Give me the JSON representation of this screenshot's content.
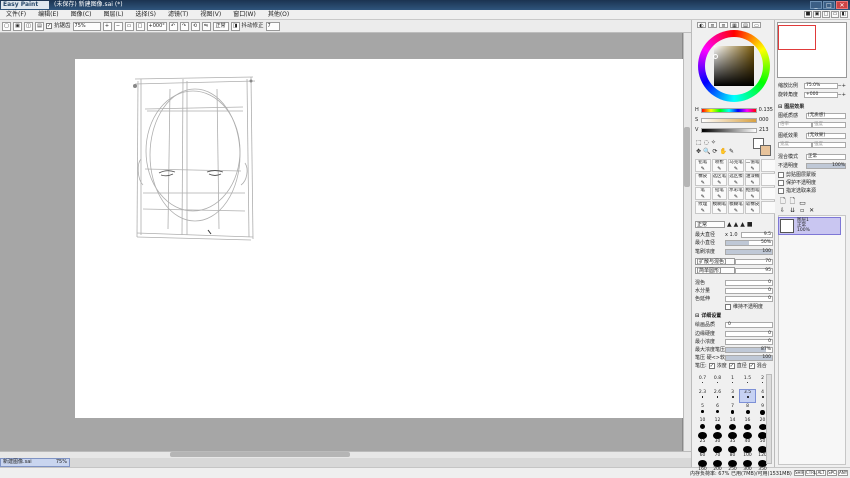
{
  "app": {
    "logo": "Easy Paint Tool SAI",
    "window_title": "(未保存) 新建图像.sai (*)",
    "window_buttons": [
      "_",
      "□",
      "✕"
    ]
  },
  "menu": {
    "items": [
      "文件(F)",
      "编辑(E)",
      "图像(C)",
      "图层(L)",
      "选择(S)",
      "滤镜(T)",
      "视图(V)",
      "窗口(W)",
      "其他(O)"
    ],
    "right_buttons": [
      "■",
      "▣",
      "□",
      "▭",
      "◧"
    ]
  },
  "toolbar": {
    "anti_alias_label": "抗锯齿",
    "zoom_value": "75%",
    "rotation_value": "+000°",
    "normal_label": "正常",
    "stabilizer_label": "抖动修正",
    "stabilizer_value": "7"
  },
  "file_tab": {
    "name": "新建图像.sai",
    "zoom": "75%"
  },
  "status": {
    "memory": "内存负荷率: 67%  已用(7MB)/可用(1531MB)",
    "buttons": [
      "SHIFT",
      "CTRL",
      "ALT",
      "SPC",
      "ANY"
    ]
  },
  "color": {
    "hue_color": "#7a5a0a",
    "sliders": [
      {
        "label": "H",
        "value": "0.135",
        "fill": "#b98d2a",
        "pct": 0.38
      },
      {
        "label": "S",
        "value": "000",
        "fill": "#d8c48e",
        "pct": 0.0
      },
      {
        "label": "V",
        "value": "213",
        "fill": "#6a6a6a",
        "pct": 0.84
      }
    ],
    "main_swatch": "#ffffff",
    "sub_swatch": "#e8c39a"
  },
  "tools": {
    "brushes": [
      {
        "label": "铅笔"
      },
      {
        "label": "喷枪"
      },
      {
        "label": "马克笔"
      },
      {
        "label": "二值笔"
      },
      {
        "label": ""
      },
      {
        "label": "橡皮"
      },
      {
        "label": "选区笔"
      },
      {
        "label": "选区擦"
      },
      {
        "label": "油漆桶"
      },
      {
        "label": ""
      },
      {
        "label": "笔"
      },
      {
        "label": "铅笔"
      },
      {
        "label": "水彩笔"
      },
      {
        "label": "抠图笔"
      },
      {
        "label": ""
      },
      {
        "label": "纹理"
      },
      {
        "label": "模糊笔"
      },
      {
        "label": "模糊笔"
      },
      {
        "label": "软橡皮"
      },
      {
        "label": ""
      }
    ]
  },
  "brush_props": {
    "mode": "正常",
    "max_size_label": "最大直径",
    "max_size_prefix": "x 1.0",
    "max_size_value": "9.5",
    "min_size_label": "最小直径",
    "min_size_value": "50%",
    "density_label": "笔刷浓度",
    "density_value": "100",
    "extended_label": "[扩散与混色]",
    "extended_value": "70",
    "shape_label": "[简单圆形]",
    "shape_value": "95",
    "mix_label": "混色",
    "mix_value": "0",
    "water_label": "水分量",
    "water_value": "0",
    "color_extend_label": "色延伸",
    "color_extend_value": "0",
    "keep_opacity_label": "维持不透明度",
    "detail_section": "详细设置",
    "quality_label": "绘画品质",
    "quality_value": "0",
    "edge_label": "边缘硬度",
    "edge_value": "0",
    "min_density_label": "最小浓度",
    "min_density_value": "0",
    "max_pressure_label": "最大浓度笔压",
    "max_pressure_value": "87%",
    "pressure_label": "笔压 硬<>软",
    "pressure_value": "100",
    "pressure_chk_label": "笔压:",
    "pressure_opts": [
      "浓度",
      "直径",
      "混合"
    ]
  },
  "brush_sizes": [
    {
      "label": "0.7",
      "d": 1
    },
    {
      "label": "0.8",
      "d": 1
    },
    {
      "label": "1",
      "d": 1
    },
    {
      "label": "1.5",
      "d": 1
    },
    {
      "label": "2",
      "d": 1
    },
    {
      "label": "2.3",
      "d": 1.5
    },
    {
      "label": "2.6",
      "d": 1.5
    },
    {
      "label": "3",
      "d": 2
    },
    {
      "label": "3.5",
      "d": 2
    },
    {
      "label": "4",
      "d": 2
    },
    {
      "label": "5",
      "d": 2.5
    },
    {
      "label": "6",
      "d": 3
    },
    {
      "label": "7",
      "d": 3.5
    },
    {
      "label": "8",
      "d": 4
    },
    {
      "label": "9",
      "d": 4.5
    },
    {
      "label": "10",
      "d": 5
    },
    {
      "label": "12",
      "d": 6
    },
    {
      "label": "14",
      "d": 7
    },
    {
      "label": "16",
      "d": 7.5
    },
    {
      "label": "20",
      "d": 8
    },
    {
      "label": "25",
      "d": 8.5
    },
    {
      "label": "30",
      "d": 9
    },
    {
      "label": "35",
      "d": 9
    },
    {
      "label": "40",
      "d": 9
    },
    {
      "label": "50",
      "d": 9
    },
    {
      "label": "60",
      "d": 9
    },
    {
      "label": "70",
      "d": 9
    },
    {
      "label": "80",
      "d": 9
    },
    {
      "label": "100",
      "d": 9
    },
    {
      "label": "120",
      "d": 9
    },
    {
      "label": "160",
      "d": 9
    },
    {
      "label": "200",
      "d": 9
    },
    {
      "label": "250",
      "d": 9
    },
    {
      "label": "300",
      "d": 9
    },
    {
      "label": "350",
      "d": 9
    }
  ],
  "selected_brush_size": "3.5",
  "navigator": {
    "zoom_label": "缩放比例",
    "zoom_value": "75.0%",
    "angle_label": "旋转角度",
    "angle_value": "+000"
  },
  "layer_effects": {
    "section": "图层效果",
    "texture_label": "图纸质感",
    "texture_value": "[无质感]",
    "texture_scale": "倍率",
    "texture_strength": "强度",
    "effect_label": "图纸效果",
    "effect_value": "[无效果]",
    "effect_width": "宽度",
    "effect_strength": "强度",
    "blend_label": "混合模式",
    "blend_value": "正常",
    "opacity_label": "不透明度",
    "opacity_value": "100%",
    "clip_label": "剪贴图层蒙版",
    "protect_label": "保护不透明度",
    "select_label": "指定选取来源"
  },
  "layer": {
    "name": "图层1",
    "mode": "正常",
    "opacity": "100%"
  }
}
